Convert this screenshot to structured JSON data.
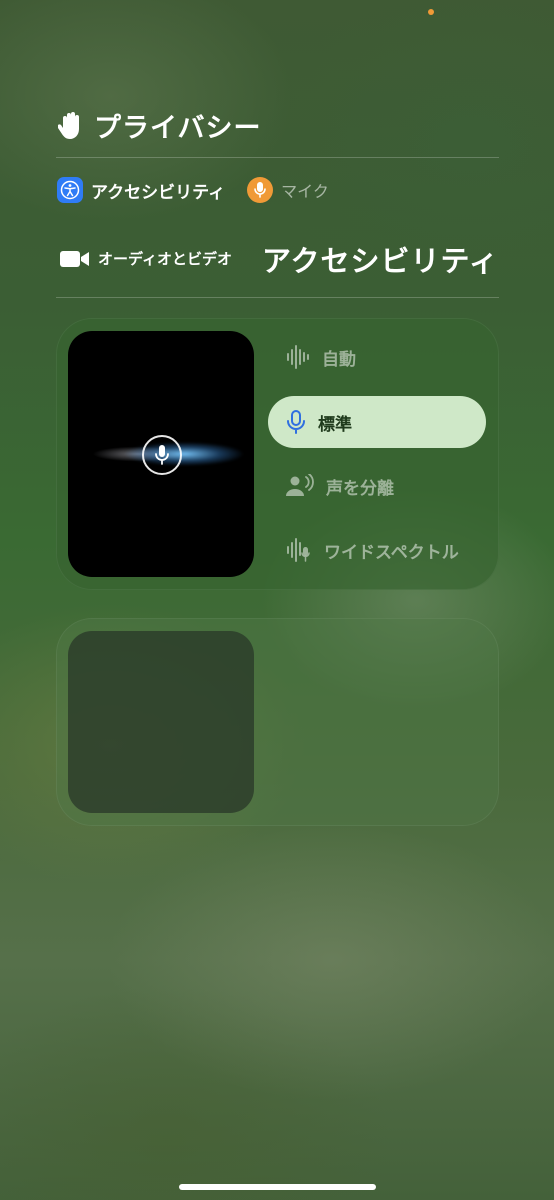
{
  "status": {
    "recording_dot_color": "#f09a37"
  },
  "privacy": {
    "title": "プライバシー",
    "icon": "hand-raised-icon"
  },
  "apps": [
    {
      "label": "アクセシビリティ",
      "icon": "accessibility-icon",
      "color": "#2f7cf6"
    },
    {
      "label": "マイク",
      "icon": "microphone-icon",
      "color": "#f09a37"
    }
  ],
  "audio_video": {
    "label": "オーディオとビデオ",
    "icon": "video-camera-icon",
    "app_name": "アクセシビリティ"
  },
  "mic_modes": {
    "selected": "標準",
    "items": [
      {
        "label": "自動",
        "icon": "waveform-icon"
      },
      {
        "label": "標準",
        "icon": "microphone-icon"
      },
      {
        "label": "声を分離",
        "icon": "person-voice-icon"
      },
      {
        "label": "ワイドスペクトル",
        "icon": "waveform-mic-icon"
      }
    ]
  }
}
